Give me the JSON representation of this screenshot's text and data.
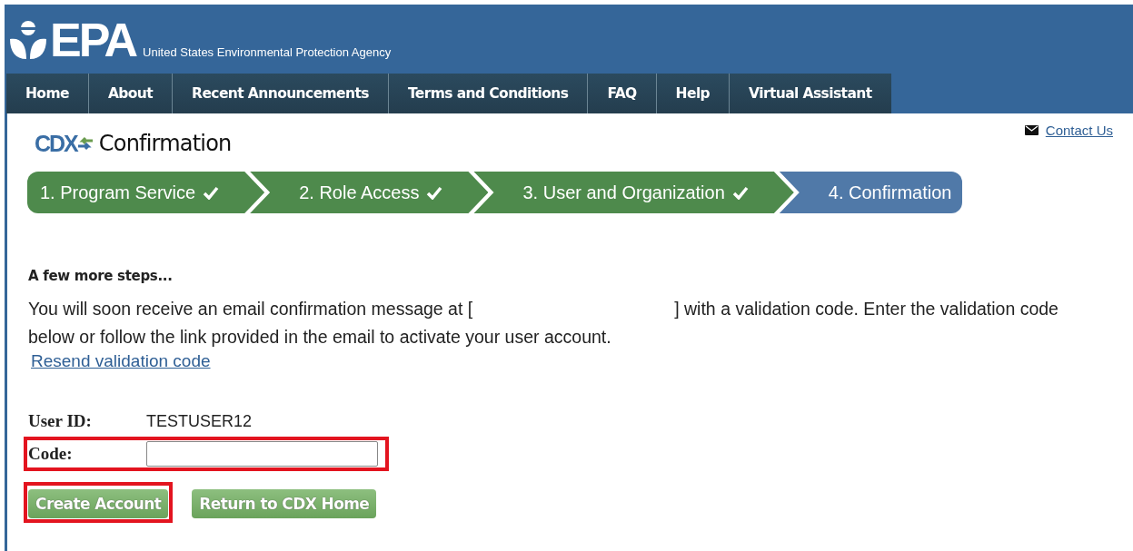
{
  "header": {
    "logo": "EPA",
    "agency": "United States Environmental Protection Agency"
  },
  "nav": [
    "Home",
    "About",
    "Recent Announcements",
    "Terms and Conditions",
    "FAQ",
    "Help",
    "Virtual Assistant"
  ],
  "contact_link": "Contact Us",
  "page": {
    "logo": "CDX",
    "title": "Confirmation"
  },
  "steps": [
    {
      "label": "1. Program Service",
      "completed": true,
      "selected": false
    },
    {
      "label": "2. Role Access",
      "completed": true,
      "selected": false
    },
    {
      "label": "3. User and Organization",
      "completed": true,
      "selected": false
    },
    {
      "label": "4. Confirmation",
      "completed": false,
      "selected": true
    }
  ],
  "section_heading": "A few more steps...",
  "message": {
    "before": "You will soon receive an email confirmation message at [",
    "after": "] with a validation code. Enter the validation code below or follow the link provided in the email to activate your user account."
  },
  "resend_link": "Resend validation code",
  "user_id": {
    "label": "User ID:",
    "value": "TESTUSER12"
  },
  "code_field": {
    "label": "Code:",
    "highlighted": true
  },
  "buttons": [
    {
      "label": "Create Account",
      "highlighted": true
    },
    {
      "label": "Return to CDX Home",
      "highlighted": false
    }
  ]
}
